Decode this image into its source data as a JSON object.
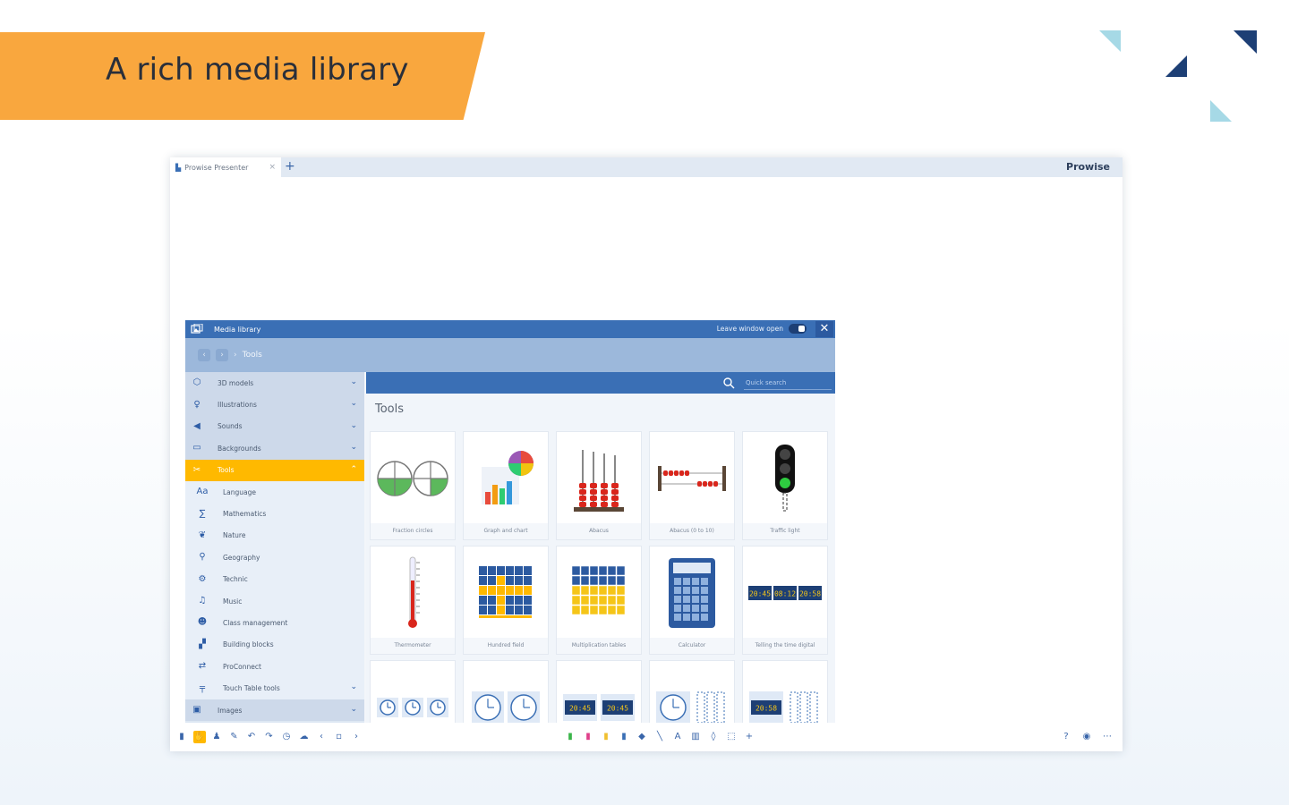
{
  "banner": {
    "title": "A rich media library"
  },
  "colors": {
    "banner": "#f9a73e",
    "accent": "#ffb900",
    "primary": "#3a6fb5",
    "navy": "#1d3f75",
    "teal": "#a6d9e6"
  },
  "browser": {
    "tab_title": "Prowise Presenter",
    "tab_close": "×",
    "new_tab": "+",
    "brand": "Prowise"
  },
  "media_library": {
    "title": "Media library",
    "keep_open_label": "Leave window open",
    "close": "✕",
    "breadcrumb": "Tools",
    "search_placeholder": "Quick search",
    "content_title": "Tools",
    "sidebar": [
      {
        "label": "3D models",
        "icon": "cube-icon",
        "type": "main"
      },
      {
        "label": "Illustrations",
        "icon": "illustration-icon",
        "type": "main"
      },
      {
        "label": "Sounds",
        "icon": "speaker-icon",
        "type": "main"
      },
      {
        "label": "Backgrounds",
        "icon": "background-icon",
        "type": "main"
      },
      {
        "label": "Tools",
        "icon": "tools-icon",
        "type": "active"
      },
      {
        "label": "Language",
        "icon": "language-icon",
        "type": "sub"
      },
      {
        "label": "Mathematics",
        "icon": "math-icon",
        "type": "sub"
      },
      {
        "label": "Nature",
        "icon": "nature-icon",
        "type": "sub"
      },
      {
        "label": "Geography",
        "icon": "location-pin-icon",
        "type": "sub"
      },
      {
        "label": "Technic",
        "icon": "technic-icon",
        "type": "sub"
      },
      {
        "label": "Music",
        "icon": "music-note-icon",
        "type": "sub"
      },
      {
        "label": "Class management",
        "icon": "people-icon",
        "type": "sub"
      },
      {
        "label": "Building blocks",
        "icon": "blocks-icon",
        "type": "sub"
      },
      {
        "label": "ProConnect",
        "icon": "connect-icon",
        "type": "sub"
      },
      {
        "label": "Touch Table tools",
        "icon": "table-icon",
        "type": "sub"
      },
      {
        "label": "Images",
        "icon": "image-icon",
        "type": "main"
      }
    ],
    "cards": [
      {
        "label": "Fraction circles",
        "thumb": "fraction-circles"
      },
      {
        "label": "Graph and chart",
        "thumb": "graph-chart"
      },
      {
        "label": "Abacus",
        "thumb": "abacus"
      },
      {
        "label": "Abacus (0 to 10)",
        "thumb": "abacus-horizontal"
      },
      {
        "label": "Traffic light",
        "thumb": "traffic-light"
      },
      {
        "label": "Thermometer",
        "thumb": "thermometer"
      },
      {
        "label": "Hundred field",
        "thumb": "hundred-field"
      },
      {
        "label": "Multiplication tables",
        "thumb": "multiplication"
      },
      {
        "label": "Calculator",
        "thumb": "calculator"
      },
      {
        "label": "Telling the time digital",
        "thumb": "digital-time"
      },
      {
        "label": "",
        "thumb": "clocks-small"
      },
      {
        "label": "",
        "thumb": "clocks-two"
      },
      {
        "label": "",
        "thumb": "digital-two"
      },
      {
        "label": "",
        "thumb": "clock-bars"
      },
      {
        "label": "",
        "thumb": "digital-bars"
      }
    ],
    "digital_readouts": [
      "20:45",
      "08:12",
      "20:58",
      "20:45",
      "20:45",
      "20:58"
    ]
  },
  "toolbar": {
    "left": [
      {
        "name": "folder-icon",
        "glyph": "▮"
      },
      {
        "name": "media-library-icon",
        "glyph": "✋",
        "active": true
      },
      {
        "name": "people-tool-icon",
        "glyph": "♟"
      },
      {
        "name": "pen-tool-icon",
        "glyph": "✎"
      },
      {
        "name": "undo-icon",
        "glyph": "↶"
      },
      {
        "name": "redo-icon",
        "glyph": "↷"
      },
      {
        "name": "timer-icon",
        "glyph": "◷"
      },
      {
        "name": "cloud-icon",
        "glyph": "☁"
      },
      {
        "name": "previous-page-icon",
        "glyph": "‹"
      },
      {
        "name": "page-indicator-icon",
        "glyph": "▫"
      },
      {
        "name": "next-page-icon",
        "glyph": "›"
      }
    ],
    "center": [
      {
        "name": "marker-green-icon",
        "glyph": "▮",
        "color": "#3bb54a"
      },
      {
        "name": "marker-pink-icon",
        "glyph": "▮",
        "color": "#e0408a"
      },
      {
        "name": "marker-yellow-icon",
        "glyph": "▮",
        "color": "#f0c030"
      },
      {
        "name": "marker-blue-icon",
        "glyph": "▮",
        "color": "#3a6fb5"
      },
      {
        "name": "fill-icon",
        "glyph": "◆"
      },
      {
        "name": "line-icon",
        "glyph": "╲"
      },
      {
        "name": "text-icon",
        "glyph": "A"
      },
      {
        "name": "shapes-icon",
        "glyph": "▥"
      },
      {
        "name": "eraser-icon",
        "glyph": "◊"
      },
      {
        "name": "select-icon",
        "glyph": "⬚"
      },
      {
        "name": "add-icon",
        "glyph": "+"
      }
    ],
    "right": [
      {
        "name": "help-icon",
        "glyph": "?"
      },
      {
        "name": "notification-icon",
        "glyph": "◉"
      },
      {
        "name": "more-icon",
        "glyph": "⋯"
      }
    ]
  }
}
